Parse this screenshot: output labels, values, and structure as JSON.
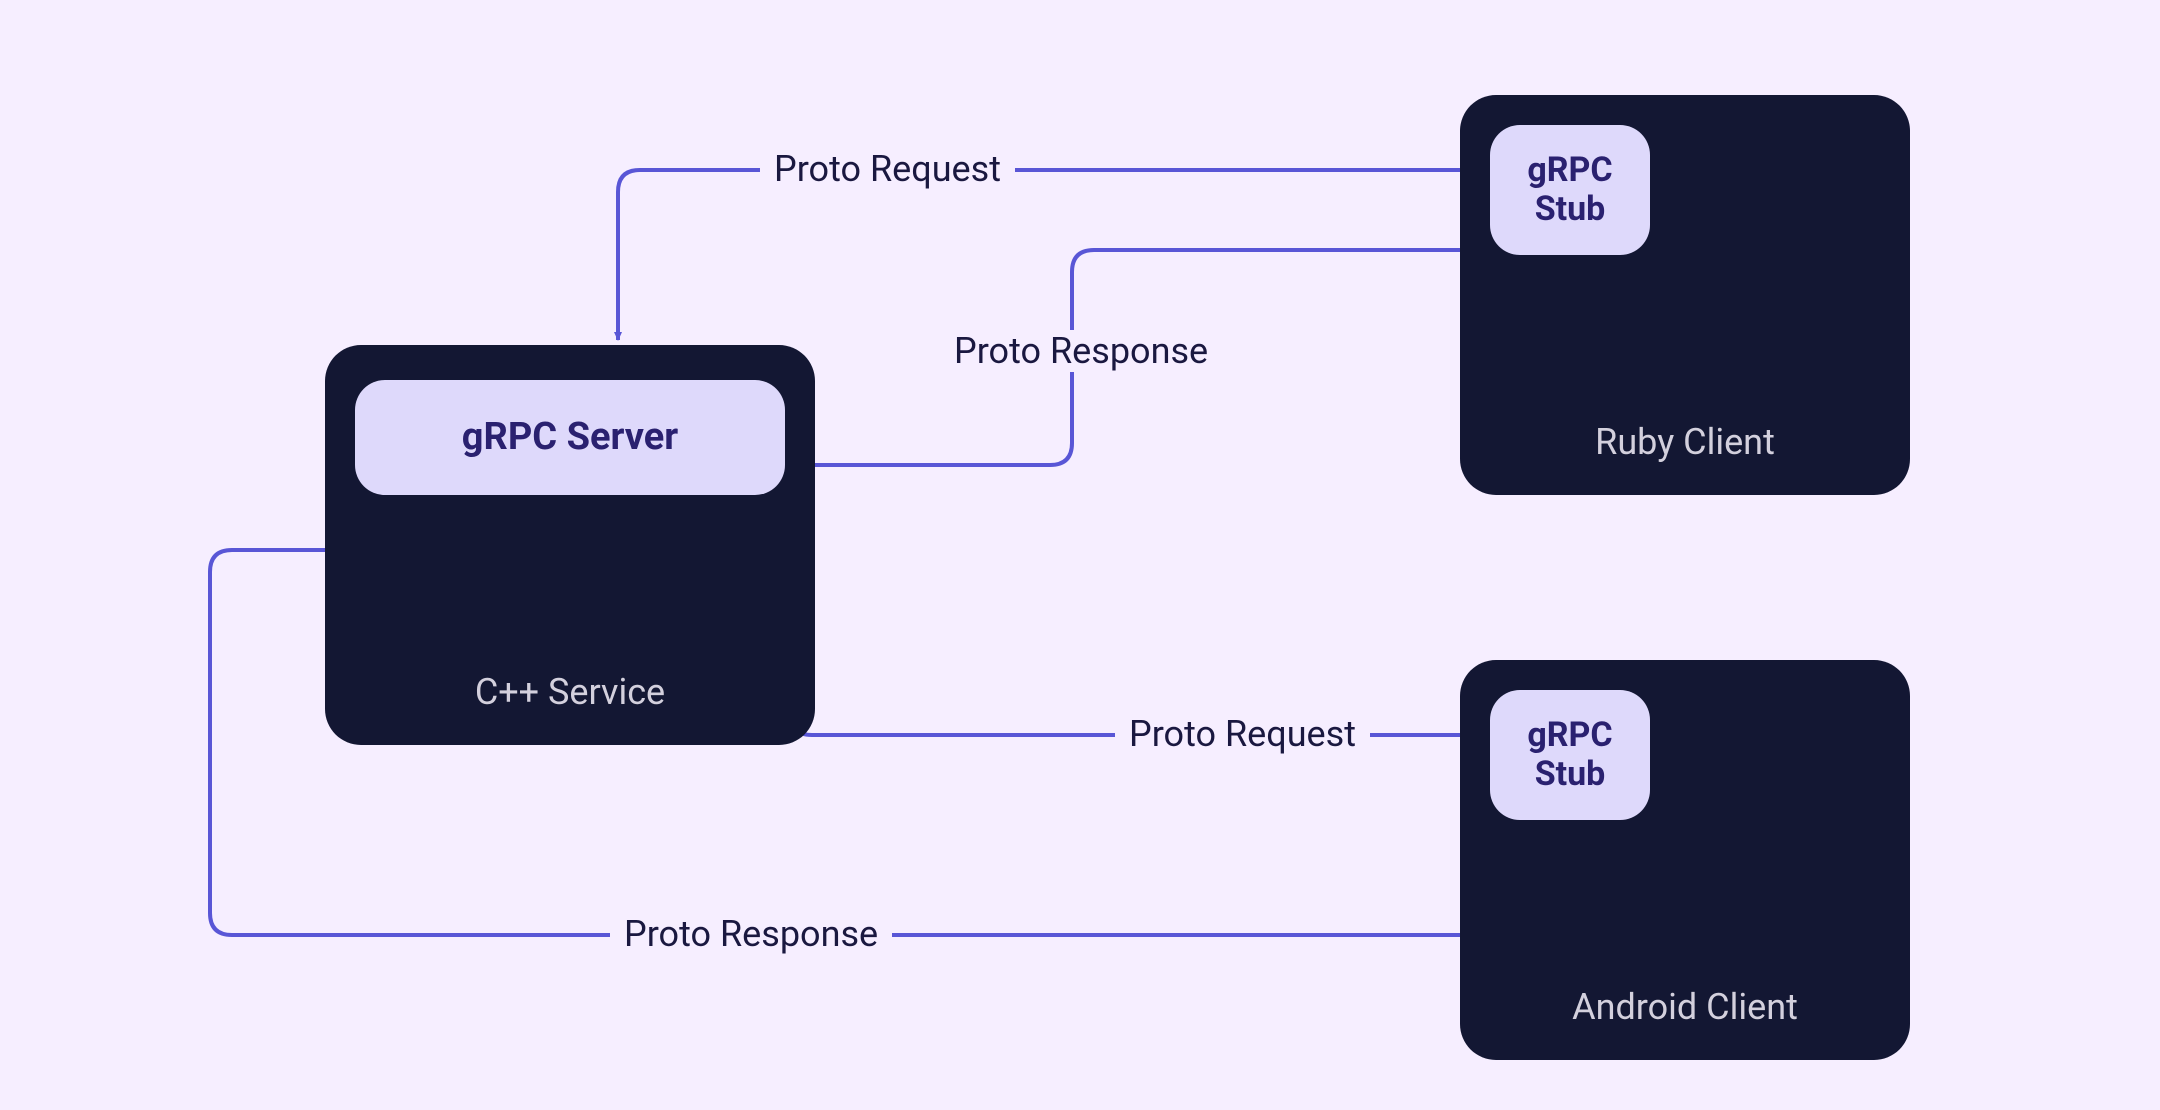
{
  "nodes": {
    "server": {
      "caption": "C++ Service",
      "pill": "gRPC Server"
    },
    "ruby": {
      "caption": "Ruby Client",
      "pill": "gRPC\nStub"
    },
    "android": {
      "caption": "Android Client",
      "pill": "gRPC\nStub"
    }
  },
  "edges": {
    "ruby_request": "Proto Request",
    "ruby_response": "Proto Response",
    "android_request": "Proto Request",
    "android_response": "Proto Response"
  },
  "colors": {
    "bg": "#f6eeff",
    "box": "#131733",
    "pill": "#ded9fb",
    "pill_text": "#2a2170",
    "arrow": "#5956d6",
    "caption": "#d3d0dd",
    "label": "#1a1840"
  }
}
